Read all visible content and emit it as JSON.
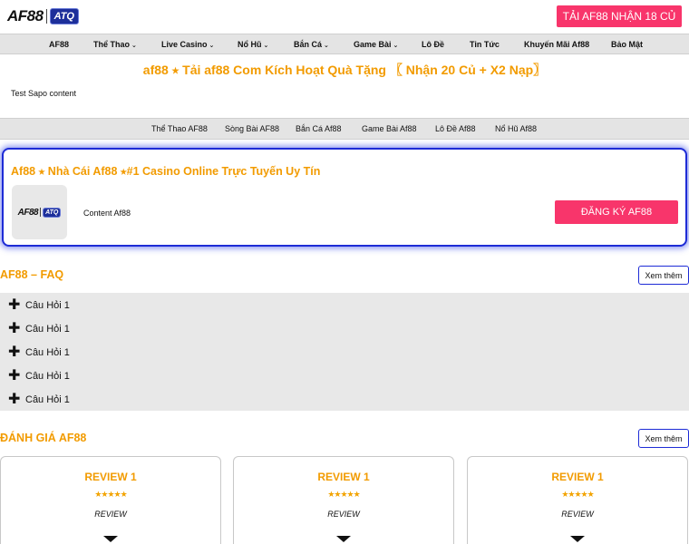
{
  "header": {
    "logo_text": "AF88",
    "logo_badge": "ATQ",
    "cta_label": "TẢI AF88   NHẬN 18 CỦ"
  },
  "nav": {
    "items": [
      {
        "label": "AF88",
        "has_dropdown": false
      },
      {
        "label": "Thể Thao",
        "has_dropdown": true
      },
      {
        "label": "Live Casino",
        "has_dropdown": true
      },
      {
        "label": "Nổ Hũ",
        "has_dropdown": true
      },
      {
        "label": "Bắn Cá",
        "has_dropdown": true
      },
      {
        "label": "Game Bài",
        "has_dropdown": true
      },
      {
        "label": "Lô Đề",
        "has_dropdown": false
      },
      {
        "label": "Tin Tức",
        "has_dropdown": false
      },
      {
        "label": "Khuyến Mãi Af88",
        "has_dropdown": false
      },
      {
        "label": "Bảo Mật",
        "has_dropdown": false
      }
    ],
    "dropdown_glyph": "⌄"
  },
  "page": {
    "title": "af88 ⭑ Tải af88 Com Kích Hoạt Quà Tặng 〖 Nhận 20 Củ + X2 Nạp〗",
    "sapo": "Test Sapo content"
  },
  "subnav": {
    "items": [
      "Thể Thao AF88",
      "Sòng Bài AF88",
      "Bắn Cá Af88",
      "Game Bài Af88",
      "Lô Đề Af88",
      "Nổ Hũ Af88"
    ]
  },
  "casino_card": {
    "title": "Af88 ⭑ Nhà Cái Af88 ⭑#1 Casino Online Trực Tuyến Uy Tín",
    "logo_text": "AF88",
    "logo_badge": "ATQ",
    "content": "Content Af88",
    "button_label": "ĐĂNG KÝ AF88"
  },
  "faq": {
    "title": "AF88 – FAQ",
    "more_label": "Xem thêm",
    "plus_glyph": "✚",
    "items": [
      "Câu Hỏi 1",
      "Câu Hỏi 1",
      "Câu Hỏi 1",
      "Câu Hỏi 1",
      "Câu Hỏi 1"
    ]
  },
  "reviews": {
    "title": "ĐÁNH GIÁ AF88",
    "more_label": "Xem thêm",
    "cards": [
      {
        "title": "REVIEW 1",
        "stars": "★★★★★",
        "rating": 5,
        "text": "REVIEW"
      },
      {
        "title": "REVIEW 1",
        "stars": "★★★★★",
        "rating": 5,
        "text": "REVIEW"
      },
      {
        "title": "REVIEW 1",
        "stars": "★★★★★",
        "rating": 5,
        "text": "REVIEW"
      }
    ]
  },
  "colors": {
    "accent_orange": "#f29b00",
    "cta_pink": "#f8356b",
    "nav_gray": "#e4e4e4",
    "card_border_blue": "#1d2bd6"
  }
}
